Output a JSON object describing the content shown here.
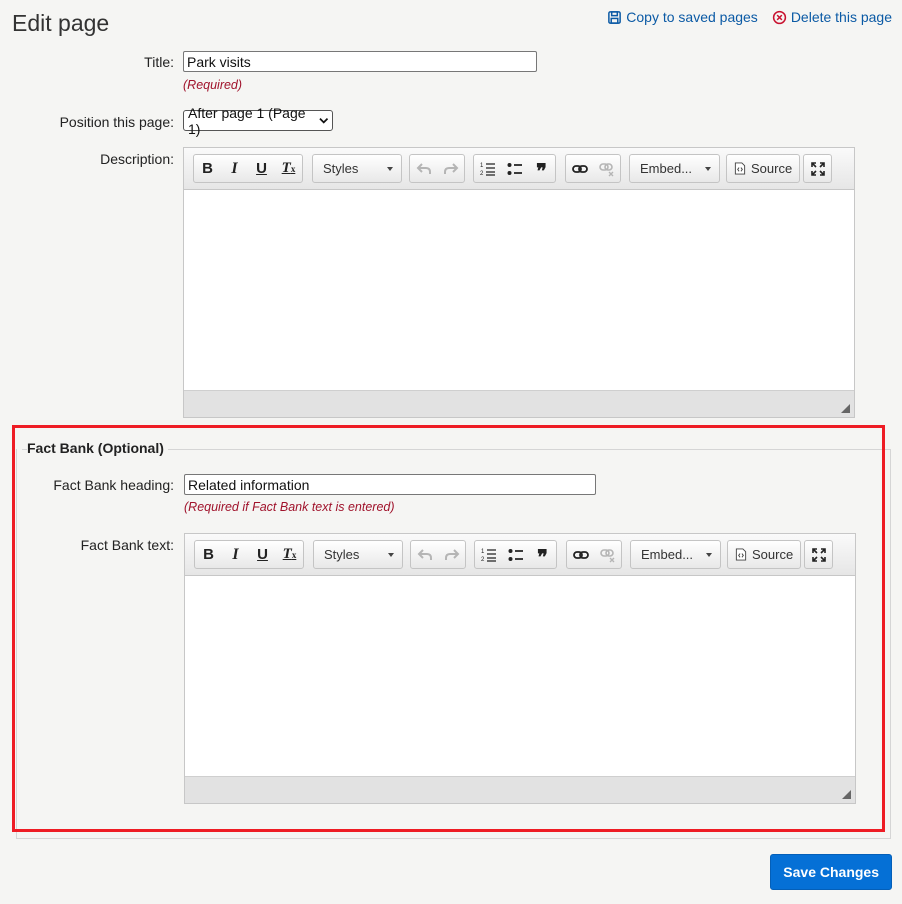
{
  "page": {
    "title": "Edit page"
  },
  "actions": {
    "copy_label": "Copy to saved pages",
    "delete_label": "Delete this page"
  },
  "fields": {
    "title_label": "Title:",
    "title_value": "Park visits",
    "title_hint": "(Required)",
    "position_label": "Position this page:",
    "position_value": "After page 1 (Page 1)",
    "description_label": "Description:"
  },
  "editor": {
    "styles_label": "Styles",
    "embed_label": "Embed...",
    "source_label": "Source"
  },
  "fact_bank": {
    "legend": "Fact Bank (Optional)",
    "heading_label": "Fact Bank heading:",
    "heading_value": "Related information",
    "heading_hint": "(Required if Fact Bank text is entered)",
    "text_label": "Fact Bank text:"
  },
  "footer": {
    "save_label": "Save Changes"
  },
  "colors": {
    "link": "#0b5aa5",
    "error": "#a0122b",
    "highlight": "#ee1c24",
    "primary": "#0570d6"
  }
}
